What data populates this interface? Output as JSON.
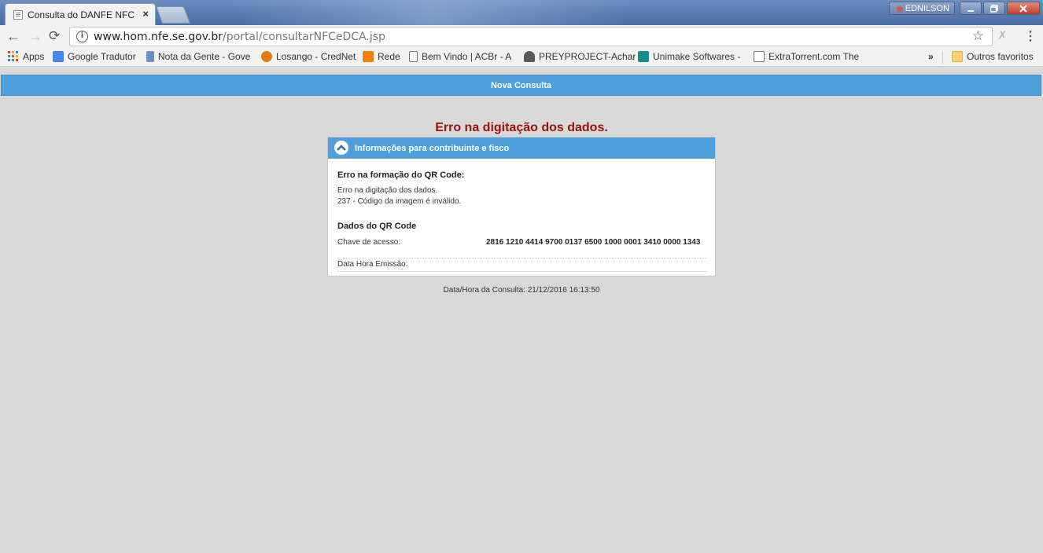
{
  "browser": {
    "tab_title": "Consulta do DANFE NFC",
    "tab_close": "×",
    "window_user": "EDNILSON",
    "url_host": "www.hom.nfe.se.gov.br",
    "url_path": "/portal/consultarNFCeDCA.jsp"
  },
  "bookmarks": {
    "items": [
      {
        "label": "Apps",
        "icon": "apps-icon",
        "color": "#e9453b"
      },
      {
        "label": "Google Tradutor",
        "icon": "google-translate-icon",
        "color": "#4285f4"
      },
      {
        "label": "Nota da Gente - Gove",
        "icon": "nota-da-gente-icon",
        "color": "#6c8fc7"
      },
      {
        "label": "Losango - CredNet",
        "icon": "losango-icon",
        "color": "#e37b1c"
      },
      {
        "label": "Rede",
        "icon": "rede-icon",
        "color": "#f07f13"
      },
      {
        "label": "Bem Vindo | ACBr - A",
        "icon": "page-icon",
        "color": "#ffffff"
      },
      {
        "label": "PREYPROJECT-Achar",
        "icon": "prey-icon",
        "color": "#5a5a5a"
      },
      {
        "label": "Unimake Softwares -",
        "icon": "unimake-icon",
        "color": "#1f8a8a"
      },
      {
        "label": "ExtraTorrent.com The",
        "icon": "extratorrent-icon",
        "color": "#7a7a7a"
      }
    ],
    "more": "»",
    "other": "Outros favoritos"
  },
  "page": {
    "nova_consulta": "Nova Consulta",
    "error_title": "Erro na digitação dos dados.",
    "card_header": "Informações para contribuinte e fisco",
    "qr_error_heading": "Erro na formação do QR Code:",
    "qr_error_line1": "Erro na digitação dos dados.",
    "qr_error_line2": "237 - Código da imagem é inválido.",
    "qr_data_heading": "Dados do QR Code",
    "chave_label": "Chave de acesso:",
    "chave_value": "2816 1210 4414 9700 0137 6500 1000 0001 3410 0000 1343",
    "data_hora_label": "Data Hora Emissão:",
    "data_hora_value": "",
    "footer": "Data/Hora da Consulta: 21/12/2016 16:13:50"
  },
  "colors": {
    "accent_blue": "#4f9fdb",
    "error_red": "#9b1111",
    "page_bg": "#d9d9d9"
  }
}
